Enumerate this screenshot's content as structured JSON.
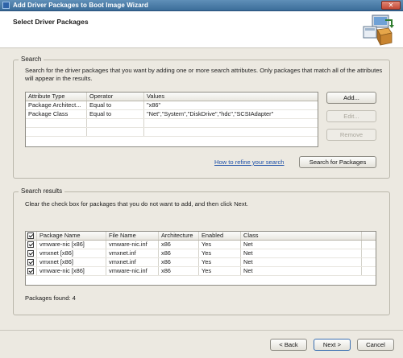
{
  "window": {
    "title": "Add Driver Packages to Boot Image Wizard",
    "close_label": "✕"
  },
  "header": {
    "title": "Select Driver Packages"
  },
  "search": {
    "group_label": "Search",
    "description": "Search for the driver packages that you want by adding one or more search attributes. Only packages that match all of the attributes will appear in the results.",
    "columns": [
      "Attribute Type",
      "Operator",
      "Values"
    ],
    "rows": [
      [
        "Package Architect...",
        "Equal to",
        "\"x86\""
      ],
      [
        "Package Class",
        "Equal to",
        "\"Net\",\"System\",\"DiskDrive\",\"hdc\",\"SCSIAdapter\""
      ]
    ],
    "add_label": "Add...",
    "edit_label": "Edit...",
    "remove_label": "Remove",
    "refine_link": "How to refine your search",
    "search_button": "Search for Packages"
  },
  "results": {
    "group_label": "Search results",
    "description": "Clear the check box for packages that you do not want to add, and then click Next.",
    "columns": [
      "Package Name",
      "File Name",
      "Architecture",
      "Enabled",
      "Class"
    ],
    "rows": [
      [
        "vmware-nic [x86]",
        "vmware-nic.inf",
        "x86",
        "Yes",
        "Net"
      ],
      [
        "vmxnet [x86]",
        "vmxnet.inf",
        "x86",
        "Yes",
        "Net"
      ],
      [
        "vmxnet [x86]",
        "vmxnet.inf",
        "x86",
        "Yes",
        "Net"
      ],
      [
        "vmware-nic [x86]",
        "vmware-nic.inf",
        "x86",
        "Yes",
        "Net"
      ]
    ],
    "found_label": "Packages found: 4"
  },
  "footer": {
    "back_label": "< Back",
    "next_label": "Next >",
    "cancel_label": "Cancel"
  }
}
